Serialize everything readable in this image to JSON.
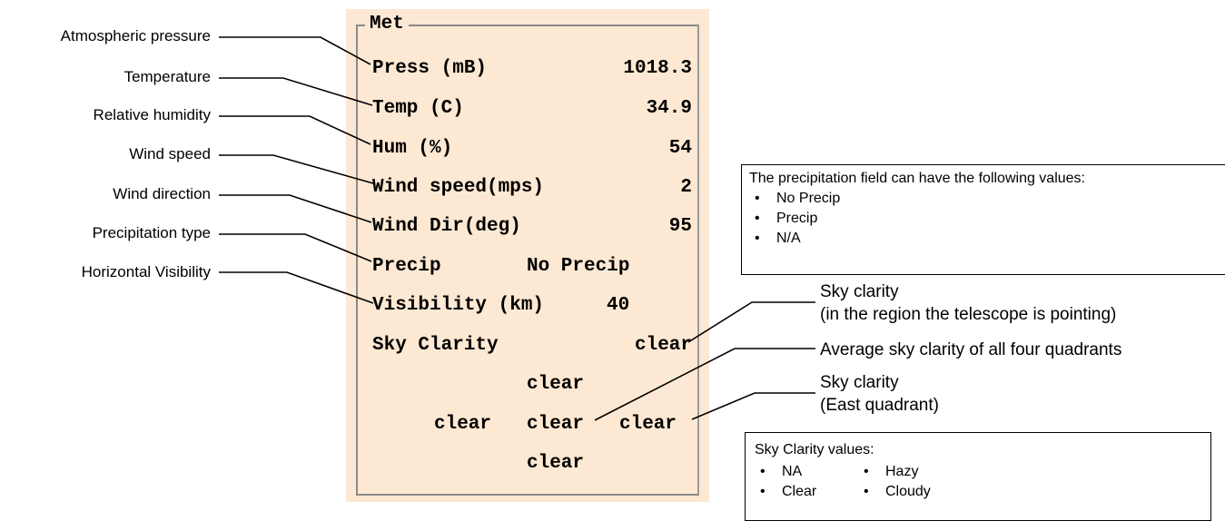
{
  "panel": {
    "title": "Met",
    "rows": [
      {
        "label": "Press (mB)",
        "value": "1018.3"
      },
      {
        "label": "Temp (C)",
        "value": "34.9"
      },
      {
        "label": "Hum (%)",
        "value": "54"
      },
      {
        "label": "Wind speed(mps)",
        "value": "2"
      },
      {
        "label": "Wind Dir(deg)",
        "value": "95"
      },
      {
        "label": "Precip",
        "value": "No Precip"
      },
      {
        "label": "Visibility (km)",
        "value": "40"
      }
    ],
    "sky": {
      "label": "Sky Clarity",
      "pointing": "clear",
      "north": "clear",
      "west": "clear",
      "average": "clear",
      "east": "clear",
      "south": "clear"
    }
  },
  "left_labels": [
    "Atmospheric pressure",
    "Temperature",
    "Relative humidity",
    "Wind speed",
    "Wind direction",
    "Precipitation type",
    "Horizontal Visibility"
  ],
  "right_callouts": {
    "sky_pointing": "Sky clarity\n(in the region the telescope is pointing)",
    "sky_average": "Average sky clarity of all four quadrants",
    "sky_east": "Sky clarity\n(East quadrant)"
  },
  "precip_box": {
    "title": "The precipitation field can have the following values:",
    "items": [
      "No Precip",
      "Precip",
      "N/A"
    ]
  },
  "sky_box": {
    "title": "Sky Clarity values:",
    "items": [
      "NA",
      "Hazy",
      "Clear",
      "Cloudy"
    ]
  }
}
